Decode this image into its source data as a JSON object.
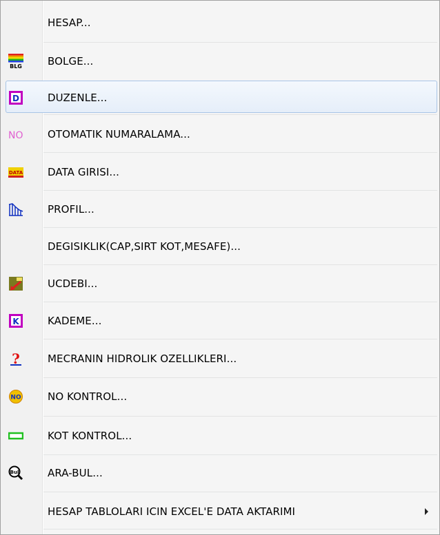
{
  "menu": {
    "items": [
      {
        "label": "HESAP...",
        "icon": null
      },
      {
        "label": "BOLGE...",
        "icon": "bolge-rainbow-icon"
      },
      {
        "label": "DUZENLE...",
        "icon": "duzenle-d-icon",
        "highlighted": true
      },
      {
        "label": "OTOMATIK NUMARALAMA...",
        "icon": "numaralama-no-icon"
      },
      {
        "label": "DATA GIRISI...",
        "icon": "data-icon"
      },
      {
        "label": "PROFIL...",
        "icon": "profil-chart-icon"
      },
      {
        "label": "DEGISIKLIK(CAP,SIRT KOT,MESAFE)...",
        "icon": null
      },
      {
        "label": "UCDEBI...",
        "icon": "ucdebi-icon"
      },
      {
        "label": "KADEME...",
        "icon": "kademe-k-icon"
      },
      {
        "label": "MECRANIN HIDROLIK OZELLIKLERI...",
        "icon": "question-icon"
      },
      {
        "label": "NO KONTROL...",
        "icon": "no-kontrol-icon"
      },
      {
        "label": "KOT KONTROL...",
        "icon": "kot-kontrol-icon"
      },
      {
        "label": "ARA-BUL...",
        "icon": "search-bul-icon"
      },
      {
        "label": "HESAP TABLOLARI ICIN EXCEL'E DATA AKTARIMI",
        "icon": null,
        "submenu": true
      }
    ],
    "icon_text": {
      "bolge": "BLG",
      "duzenle": "D",
      "numaralama": "NO",
      "data": "DATA",
      "kademe": "K",
      "no_kontrol": "NO",
      "ara_bul": "Bul"
    },
    "colors": {
      "hover_border": "#a8c4e6",
      "hover_fill": "#e5eef9",
      "separator": "#e2e3e3",
      "gutter": "#f1f1f1"
    }
  }
}
